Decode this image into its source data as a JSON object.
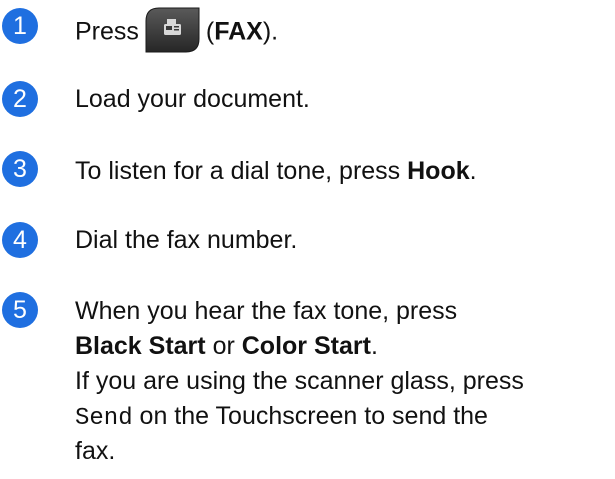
{
  "steps": [
    {
      "number": "1",
      "press": "Press",
      "open_paren": "(",
      "fax_label": "FAX",
      "close": ")."
    },
    {
      "number": "2",
      "text": "Load your document."
    },
    {
      "number": "3",
      "text": "To listen for a dial tone, press ",
      "bold": "Hook",
      "end": "."
    },
    {
      "number": "4",
      "text": "Dial the fax number."
    },
    {
      "number": "5",
      "line1": "When you hear the fax tone, press",
      "black_start": "Black Start",
      "or": " or ",
      "color_start": "Color Start",
      "period": ".",
      "line3": "If you are using the scanner glass, press",
      "send": "Send",
      "line4_rest": " on the Touchscreen to send the",
      "line5": "fax."
    }
  ],
  "colors": {
    "badge": "#1f6fe0",
    "fax_button_body": "#3a3a3a",
    "fax_icon": "#d8d8d8"
  },
  "icons": {
    "fax_button": "fax-icon"
  }
}
